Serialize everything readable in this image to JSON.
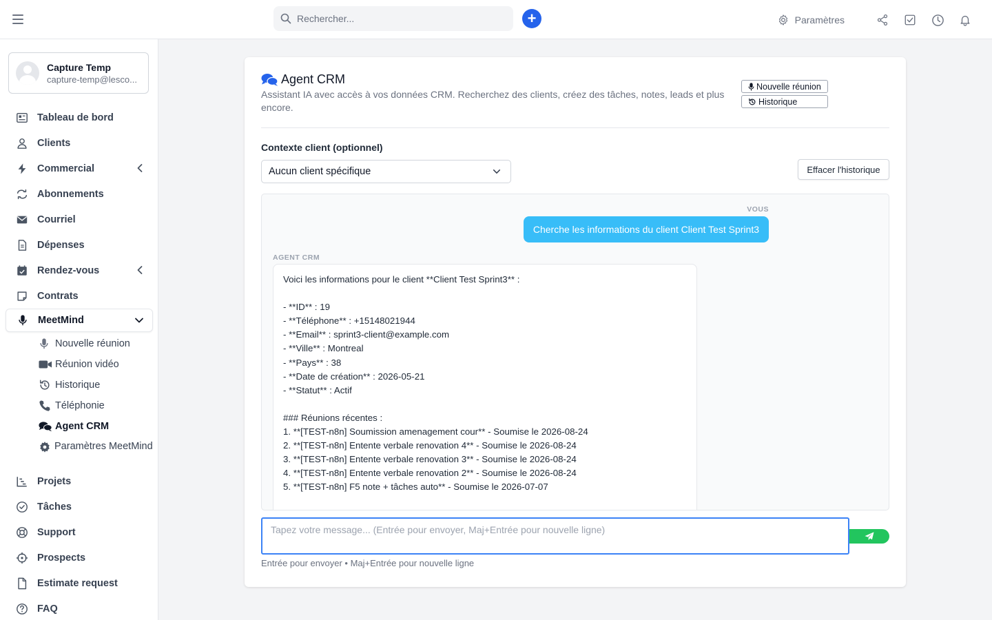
{
  "topbar": {
    "search_placeholder": "Rechercher...",
    "add_label": "+",
    "settings_label": "Paramètres"
  },
  "user": {
    "name": "Capture Temp",
    "email": "capture-temp@lesco..."
  },
  "nav": {
    "dashboard": "Tableau de bord",
    "clients": "Clients",
    "commercial": "Commercial",
    "subscriptions": "Abonnements",
    "mail": "Courriel",
    "expenses": "Dépenses",
    "appointments": "Rendez-vous",
    "contracts": "Contrats",
    "meetmind": "MeetMind",
    "meetmind_sub": {
      "new_meeting": "Nouvelle réunion",
      "video_meeting": "Réunion vidéo",
      "history": "Historique",
      "phone": "Téléphonie",
      "agent_crm": "Agent CRM",
      "settings": "Paramètres MeetMind"
    },
    "projects": "Projets",
    "tasks": "Tâches",
    "support": "Support",
    "prospects": "Prospects",
    "estimate": "Estimate request",
    "faq": "FAQ"
  },
  "agent": {
    "title": "Agent CRM",
    "subtitle": "Assistant IA avec accès à vos données CRM. Recherchez des clients, créez des tâches, notes, leads et plus encore.",
    "new_meeting_btn": "Nouvelle réunion",
    "history_btn": "Historique",
    "context_label": "Contexte client (optionnel)",
    "context_value": "Aucun client spécifique",
    "clear_history": "Effacer l'historique"
  },
  "chat": {
    "user_label": "VOUS",
    "user_message": "Cherche les informations du client Client Test Sprint3",
    "agent_label": "AGENT CRM",
    "agent_message": "Voici les informations pour le client **Client Test Sprint3** :\n\n- **ID** : 19\n- **Téléphone** : +15148021944\n- **Email** : sprint3-client@example.com\n- **Ville** : Montreal\n- **Pays** : 38\n- **Date de création** : 2026-05-21\n- **Statut** : Actif\n\n### Réunions récentes :\n1. **[TEST-n8n] Soumission amenagement cour** - Soumise le 2026-08-24\n2. **[TEST-n8n] Entente verbale renovation 4** - Soumise le 2026-08-24\n3. **[TEST-n8n] Entente verbale renovation 3** - Soumise le 2026-08-24\n4. **[TEST-n8n] Entente verbale renovation 2** - Soumise le 2026-08-24\n5. **[TEST-n8n] F5 note + tâches auto** - Soumise le 2026-07-07"
  },
  "composer": {
    "placeholder": "Tapez votre message... (Entrée pour envoyer, Maj+Entrée pour nouvelle ligne)",
    "hint": "Entrée pour envoyer • Maj+Entrée pour nouvelle ligne"
  },
  "colors": {
    "primary": "#2563eb",
    "user_bubble": "#38bdf8",
    "send": "#22c55e"
  }
}
